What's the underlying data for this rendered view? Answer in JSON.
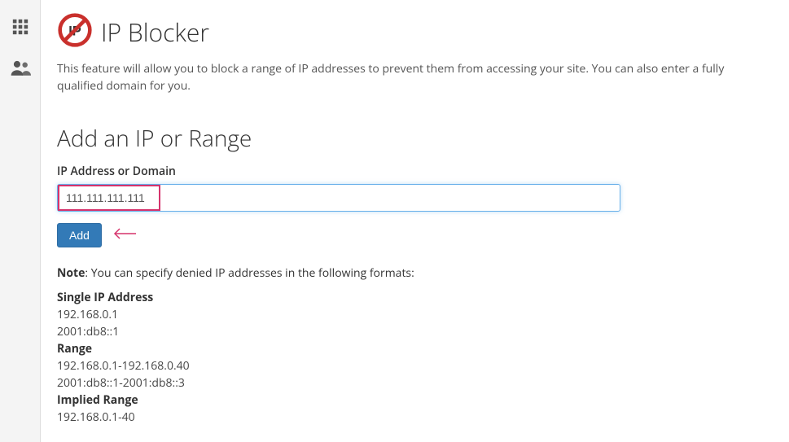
{
  "sidebar": {
    "icons": [
      "grid-icon",
      "users-icon"
    ]
  },
  "header": {
    "title": "IP Blocker"
  },
  "intro": {
    "text": "This feature will allow you to block a range of IP addresses to prevent them from accessing your site. You can also enter a fully qualified domain for you."
  },
  "form": {
    "section_title": "Add an IP or Range",
    "input_label": "IP Address or Domain",
    "input_value": "111.111.111.111",
    "add_button": "Add"
  },
  "note": {
    "prefix": "Note",
    "text": ": You can specify denied IP addresses in the following formats:"
  },
  "formats": [
    {
      "title": "Single IP Address",
      "examples": [
        "192.168.0.1",
        "2001:db8::1"
      ]
    },
    {
      "title": "Range",
      "examples": [
        "192.168.0.1-192.168.0.40",
        "2001:db8::1-2001:db8::3"
      ]
    },
    {
      "title": "Implied Range",
      "examples": [
        "192.168.0.1-40"
      ]
    }
  ]
}
